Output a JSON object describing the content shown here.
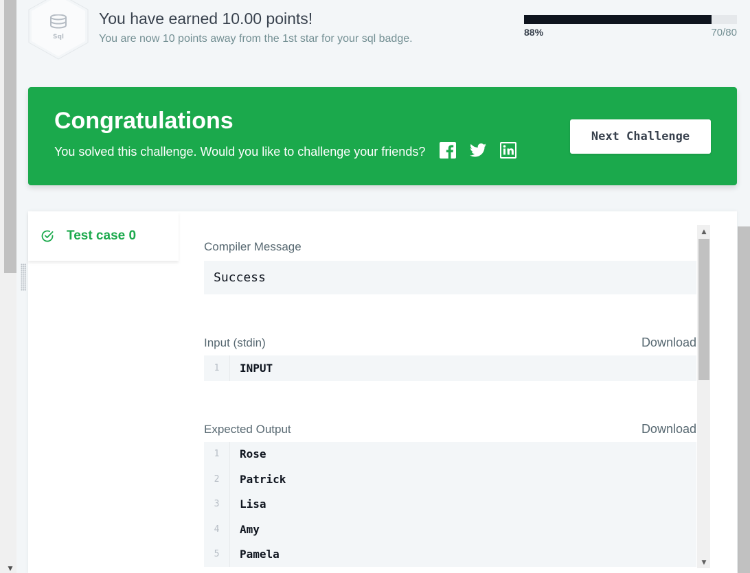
{
  "header": {
    "badge_label": "Sql",
    "points_title": "You have earned 10.00 points!",
    "points_subtitle": "You are now 10 points away from the 1st star for your sql badge.",
    "progress_percent_label": "88%",
    "progress_count": "70/80",
    "progress_fraction": 0.88
  },
  "banner": {
    "title": "Congratulations",
    "message": "You solved this challenge. Would you like to challenge your friends?",
    "share_icons": [
      "facebook-icon",
      "twitter-icon",
      "linkedin-icon"
    ],
    "next_button": "Next Challenge",
    "color": "#1ba94c"
  },
  "results": {
    "tab_label": "Test case 0",
    "compiler_label": "Compiler Message",
    "compiler_message": "Success",
    "input_label": "Input (stdin)",
    "input_download": "Download",
    "input_lines": [
      {
        "num": "1",
        "text": "INPUT"
      }
    ],
    "expected_label": "Expected Output",
    "expected_download": "Download",
    "expected_lines": [
      {
        "num": "1",
        "text": "Rose"
      },
      {
        "num": "2",
        "text": "Patrick"
      },
      {
        "num": "3",
        "text": "Lisa"
      },
      {
        "num": "4",
        "text": "Amy"
      },
      {
        "num": "5",
        "text": "Pamela"
      }
    ]
  }
}
